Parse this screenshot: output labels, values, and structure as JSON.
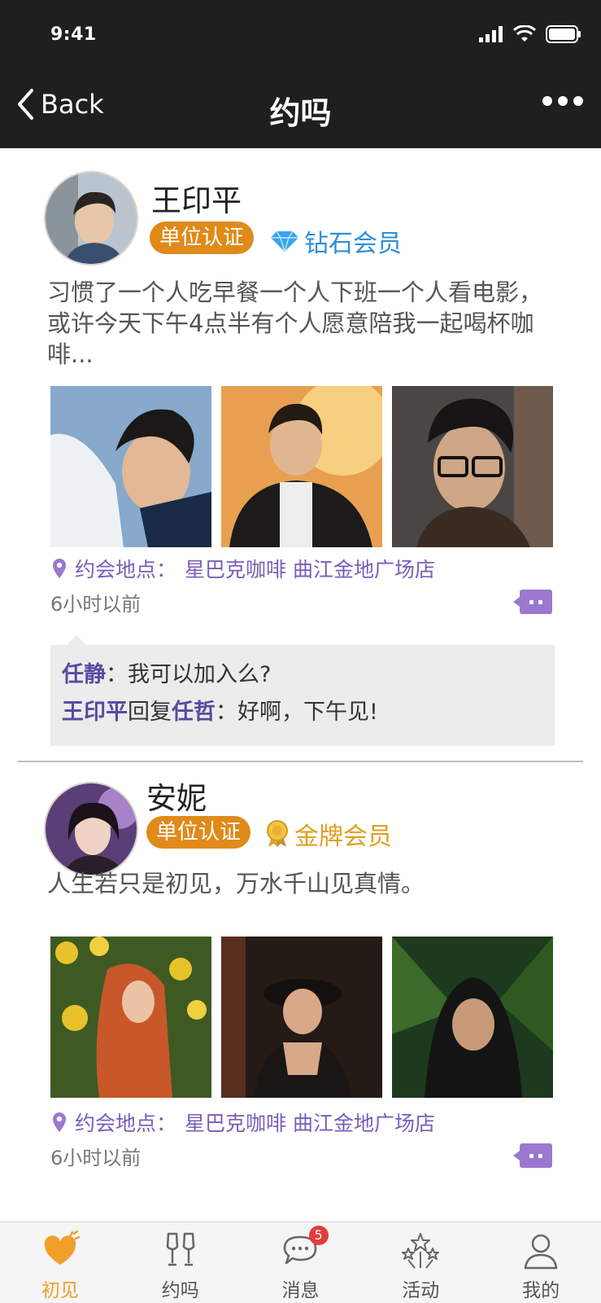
{
  "status_bar": {
    "time": "9:41"
  },
  "nav": {
    "back_label": "Back",
    "title": "约吗"
  },
  "posts": [
    {
      "username": "王印平",
      "cert_badge": "单位认证",
      "member_type": "钻石会员",
      "member_icon": "diamond-icon",
      "text": "习惯了一个人吃早餐一个人下班一个人看电影，或许今天下午4点半有个人愿意陪我一起喝杯咖啡...",
      "location_label": "约会地点：",
      "location_value": "星巴克咖啡 曲江金地广场店",
      "time_ago": "6小时以前",
      "comments": [
        {
          "author": "任静",
          "sep": "：",
          "text": "我可以加入么?"
        },
        {
          "author": "王印平",
          "reply_word": "回复",
          "target": "任哲",
          "sep": "：",
          "text": "好啊，下午见!"
        }
      ]
    },
    {
      "username": "安妮",
      "cert_badge": "单位认证",
      "member_type": "金牌会员",
      "member_icon": "gold-medal-icon",
      "text": "人生若只是初见，万水千山见真情。",
      "location_label": "约会地点：",
      "location_value": "星巴克咖啡 曲江金地广场店",
      "time_ago": "6小时以前"
    }
  ],
  "tabbar": {
    "items": [
      {
        "label": "初见",
        "icon": "heart-icon",
        "active": true
      },
      {
        "label": "约吗",
        "icon": "wine-glasses-icon"
      },
      {
        "label": "消息",
        "icon": "chat-bubble-icon",
        "badge": "5"
      },
      {
        "label": "活动",
        "icon": "fireworks-icon"
      },
      {
        "label": "我的",
        "icon": "person-icon"
      }
    ]
  },
  "colors": {
    "header_bg": "#1f1f1f",
    "cert_badge": "#e08a1a",
    "diamond": "#2f8fd8",
    "gold": "#e0a020",
    "accent_purple": "#7a5db8",
    "tab_active": "#f0a02a",
    "badge_red": "#e33b3b"
  }
}
